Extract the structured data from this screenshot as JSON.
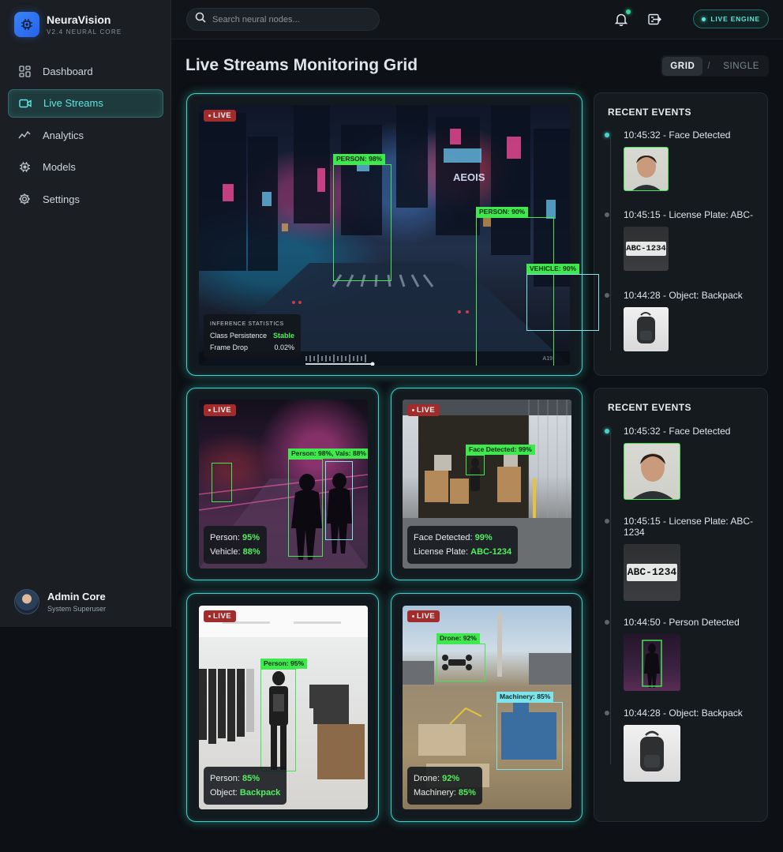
{
  "brand": {
    "name": "NeuraVision",
    "subtitle": "V2.4 NEURAL CORE"
  },
  "nav": [
    {
      "label": "Dashboard",
      "icon": "dashboard-icon",
      "active": false
    },
    {
      "label": "Live Streams",
      "icon": "video-icon",
      "active": true
    },
    {
      "label": "Analytics",
      "icon": "analytics-icon",
      "active": false
    },
    {
      "label": "Models",
      "icon": "chip-icon",
      "active": false
    },
    {
      "label": "Settings",
      "icon": "gear-icon",
      "active": false
    }
  ],
  "user": {
    "name": "Admin Core",
    "role": "System Superuser"
  },
  "topbar": {
    "search_placeholder": "Search neural nodes...",
    "engine_label": "LIVE ENGINE"
  },
  "page": {
    "title": "Live Streams Monitoring Grid"
  },
  "view_toggle": {
    "grid": "GRID",
    "separator": "/",
    "single": "SINGLE",
    "selected": "GRID"
  },
  "colors": {
    "accent": "#3bd5cc",
    "detection": "#3ee84d",
    "live": "#a22b2b",
    "active_text": "#5ee6e0"
  },
  "streams": {
    "main": {
      "badge": "LIVE",
      "detections": [
        {
          "label": "PERSON: 98%",
          "color": "green"
        },
        {
          "label": "PERSON: 90%",
          "color": "green"
        },
        {
          "label": "VEHICLE: 90%",
          "color": "green"
        }
      ],
      "inference": {
        "title": "INFERENCE STATISTICS",
        "class_label": "Class Persistence",
        "class_value": "Stable",
        "drop_label": "Frame Drop",
        "drop_value": "0.02%"
      },
      "timecode": "A19"
    },
    "street": {
      "badge": "LIVE",
      "detections": [
        {
          "label": "Person: 98%, Vals: 88%"
        }
      ],
      "stats": [
        {
          "label": "Person:",
          "value": "95%"
        },
        {
          "label": "Vehicle:",
          "value": "88%"
        }
      ]
    },
    "warehouse": {
      "badge": "LIVE",
      "detections": [
        {
          "label": "Face Detected: 99%"
        }
      ],
      "stats": [
        {
          "label": "Face Detected:",
          "value": "99%"
        },
        {
          "label": "License Plate:",
          "value": "ABC-1234"
        }
      ]
    },
    "retail": {
      "badge": "LIVE",
      "detections": [
        {
          "label": "Person: 95%"
        }
      ],
      "stats": [
        {
          "label": "Person:",
          "value": "85%"
        },
        {
          "label": "Object:",
          "value": "Backpack"
        }
      ]
    },
    "industrial": {
      "badge": "LIVE",
      "detections": [
        {
          "label": "Drone: 92%"
        },
        {
          "label": "Machinery: 85%"
        }
      ],
      "stats": [
        {
          "label": "Drone:",
          "value": "92%"
        },
        {
          "label": "Machinery:",
          "value": "85%"
        }
      ]
    }
  },
  "events_panels": [
    {
      "title": "RECENT EVENTS",
      "events": [
        {
          "text": "10:45:32 - Face Detected",
          "thumb": "face"
        },
        {
          "text": "10:45:15 - License Plate: ABC-",
          "thumb": "plate",
          "plate_text": "ABC-1234"
        },
        {
          "text": "10:44:28 - Object: Backpack",
          "thumb": "bag"
        }
      ]
    },
    {
      "title": "RECENT EVENTS",
      "events": [
        {
          "text": "10:45:32 - Face Detected",
          "thumb": "face"
        },
        {
          "text": "10:45:15 - License Plate: ABC-1234",
          "thumb": "plate",
          "plate_text": "ABC-1234"
        },
        {
          "text": "10:44:50 - Person Detected",
          "thumb": "person"
        },
        {
          "text": "10:44:28 - Object: Backpack",
          "thumb": "bag"
        }
      ]
    }
  ]
}
